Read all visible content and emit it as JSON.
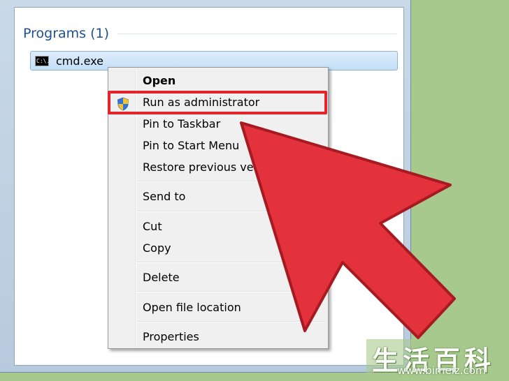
{
  "start_menu": {
    "group_title": "Programs (1)",
    "result_label": "cmd.exe",
    "cmd_icon_text": "C:\\."
  },
  "context_menu": {
    "items": [
      {
        "label": "Open",
        "bold": true
      },
      {
        "label": "Run as administrator",
        "icon": "uac-shield-icon"
      },
      {
        "label": "Pin to Taskbar"
      },
      {
        "label": "Pin to Start Menu"
      },
      {
        "label": "Restore previous versions"
      },
      {
        "label": "Send to"
      },
      {
        "label": "Cut"
      },
      {
        "label": "Copy"
      },
      {
        "label": "Delete"
      },
      {
        "label": "Open file location"
      },
      {
        "label": "Properties"
      }
    ]
  },
  "overlay": {
    "highlight_color": "#e3242b",
    "arrow_color": "#e3323b"
  },
  "watermark": {
    "chinese": "生活百科",
    "url": "www.bimeiz.com"
  }
}
